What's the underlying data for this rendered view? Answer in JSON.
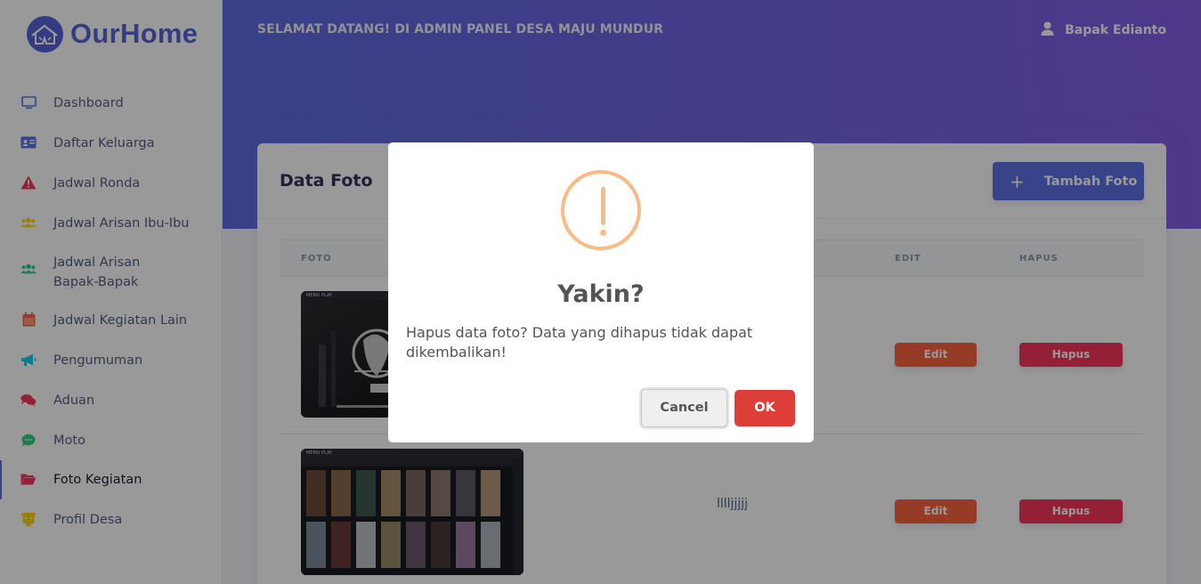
{
  "brand": {
    "name": "OurHome",
    "color": "#5b65d9",
    "logo_icon": "house-logo-icon"
  },
  "sidebar": {
    "items": [
      {
        "label": "Dashboard",
        "icon": "monitor-icon",
        "color": "#5e72e4"
      },
      {
        "label": "Daftar Keluarga",
        "icon": "id-card-icon",
        "color": "#5e72e4"
      },
      {
        "label": "Jadwal Ronda",
        "icon": "warning-icon",
        "color": "#f5365c"
      },
      {
        "label": "Jadwal Arisan Ibu-Ibu",
        "icon": "users-icon",
        "color": "#ffd600"
      },
      {
        "label": "Jadwal Arisan Bapak-Bapak",
        "icon": "users-icon",
        "color": "#2dce89"
      },
      {
        "label": "Jadwal Kegiatan Lain",
        "icon": "calendar-icon",
        "color": "#fb6340"
      },
      {
        "label": "Pengumuman",
        "icon": "megaphone-icon",
        "color": "#11cdef"
      },
      {
        "label": "Aduan",
        "icon": "comments-icon",
        "color": "#f5365c"
      },
      {
        "label": "Moto",
        "icon": "chat-icon",
        "color": "#2dce89"
      },
      {
        "label": "Foto Kegiatan",
        "icon": "folder-icon",
        "color": "#f5365c",
        "active": true
      },
      {
        "label": "Profil Desa",
        "icon": "building-icon",
        "color": "#ffd600"
      }
    ]
  },
  "header": {
    "welcome": "SELAMAT DATANG! DI ADMIN PANEL DESA MAJU MUNDUR",
    "user_name": "Bapak Edianto"
  },
  "card": {
    "title": "Data Foto",
    "add_button": "Tambah Foto",
    "columns": {
      "foto": "FOTO",
      "edit": "EDIT",
      "hapus": "HAPUS"
    },
    "rows": [
      {
        "description": "",
        "thumb_label": "MEMU PLAY",
        "edit_label": "Edit",
        "delete_label": "Hapus"
      },
      {
        "description": "lllljjjjj",
        "thumb_label": "MEMU PLAY",
        "edit_label": "Edit",
        "delete_label": "Hapus"
      }
    ]
  },
  "modal": {
    "title": "Yakin?",
    "text": "Hapus data foto? Data yang dihapus tidak dapat dikembalikan!",
    "cancel_label": "Cancel",
    "ok_label": "OK",
    "icon": "warning-circle-icon",
    "accent": "#f8bb86"
  },
  "colors": {
    "primary": "#5e72e4",
    "edit": "#fb6340",
    "delete": "#f5365c",
    "ok": "#dd3e38"
  }
}
